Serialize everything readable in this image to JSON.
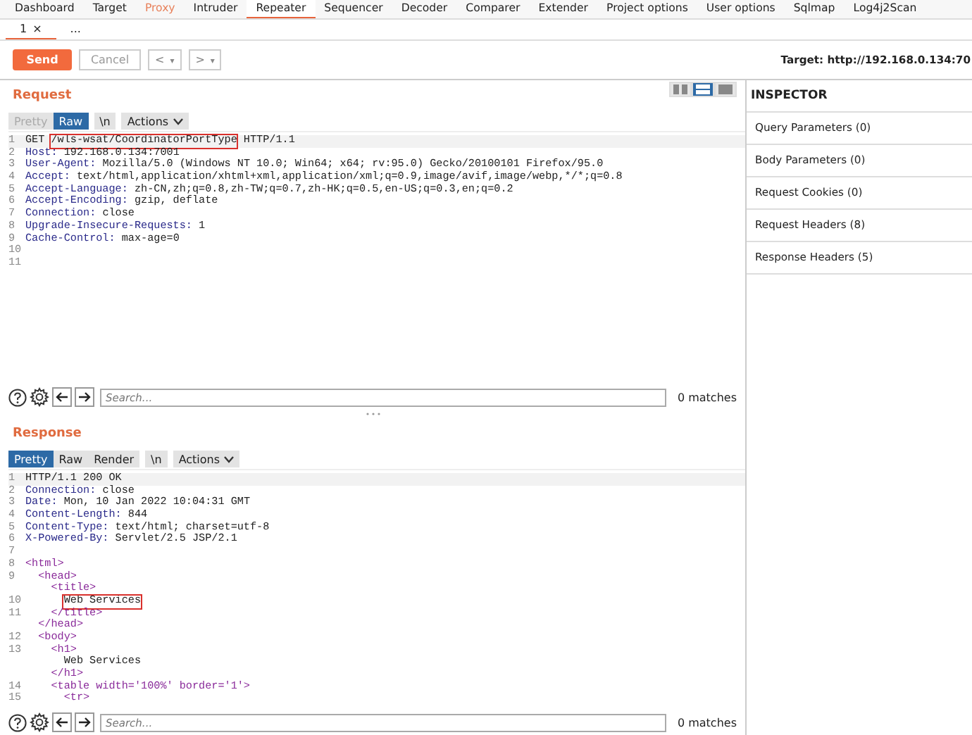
{
  "main_tabs": [
    {
      "label": "Dashboard",
      "selected": false,
      "alert": false
    },
    {
      "label": "Target",
      "selected": false,
      "alert": false
    },
    {
      "label": "Proxy",
      "selected": false,
      "alert": true
    },
    {
      "label": "Intruder",
      "selected": false,
      "alert": false
    },
    {
      "label": "Repeater",
      "selected": true,
      "alert": false
    },
    {
      "label": "Sequencer",
      "selected": false,
      "alert": false
    },
    {
      "label": "Decoder",
      "selected": false,
      "alert": false
    },
    {
      "label": "Comparer",
      "selected": false,
      "alert": false
    },
    {
      "label": "Extender",
      "selected": false,
      "alert": false
    },
    {
      "label": "Project options",
      "selected": false,
      "alert": false
    },
    {
      "label": "User options",
      "selected": false,
      "alert": false
    },
    {
      "label": "Sqlmap",
      "selected": false,
      "alert": false
    },
    {
      "label": "Log4j2Scan",
      "selected": false,
      "alert": false
    }
  ],
  "sub_tabs": [
    {
      "label": "1",
      "close": "×",
      "selected": true
    },
    {
      "label": "...",
      "selected": false
    }
  ],
  "toolbar": {
    "send": "Send",
    "cancel": {
      "label": "Cancel",
      "disabled": true
    },
    "back": "<",
    "forward": ">",
    "dropdown": "▾",
    "target": "Target: http://192.168.0.134:70"
  },
  "request": {
    "title": "Request",
    "view_modes": [
      {
        "selected": false
      },
      {
        "selected": true
      },
      {
        "selected": false
      }
    ],
    "format_tabs": [
      {
        "label": "Pretty",
        "selected": false,
        "disabled": true
      },
      {
        "label": "Raw",
        "selected": true,
        "disabled": false
      }
    ],
    "newline": "\\n",
    "actions": "Actions",
    "lines": [
      {
        "number": "1",
        "kind": "request_line",
        "method": "GET",
        "path": "/wls-wsat/CoordinatorPortType",
        "version": "HTTP/1.1",
        "highlighted": true
      },
      {
        "number": "2",
        "kind": "header",
        "name": "Host:",
        "value": "192.168.0.134:7001"
      },
      {
        "number": "3",
        "kind": "header",
        "name": "User-Agent:",
        "value": "Mozilla/5.0 (Windows NT 10.0; Win64; x64; rv:95.0) Gecko/20100101 Firefox/95.0"
      },
      {
        "number": "4",
        "kind": "header",
        "name": "Accept:",
        "value": "text/html,application/xhtml+xml,application/xml;q=0.9,image/avif,image/webp,*/*;q=0.8"
      },
      {
        "number": "5",
        "kind": "header",
        "name": "Accept-Language:",
        "value": "zh-CN,zh;q=0.8,zh-TW;q=0.7,zh-HK;q=0.5,en-US;q=0.3,en;q=0.2"
      },
      {
        "number": "6",
        "kind": "header",
        "name": "Accept-Encoding:",
        "value": "gzip, deflate"
      },
      {
        "number": "7",
        "kind": "header",
        "name": "Connection:",
        "value": "close"
      },
      {
        "number": "8",
        "kind": "header",
        "name": "Upgrade-Insecure-Requests:",
        "value": "1"
      },
      {
        "number": "9",
        "kind": "header",
        "name": "Cache-Control:",
        "value": "max-age=0"
      },
      {
        "number": "10",
        "kind": "blank"
      },
      {
        "number": "11",
        "kind": "blank"
      }
    ],
    "search": {
      "placeholder": "Search...",
      "matches": "0 matches"
    }
  },
  "response": {
    "title": "Response",
    "format_tabs": [
      {
        "label": "Pretty",
        "selected": true,
        "disabled": false
      },
      {
        "label": "Raw",
        "selected": false,
        "disabled": false
      },
      {
        "label": "Render",
        "selected": false,
        "disabled": false
      }
    ],
    "newline": "\\n",
    "actions": "Actions",
    "lines": [
      {
        "number": "1",
        "kind": "status_line",
        "text": "HTTP/1.1 200 OK"
      },
      {
        "number": "2",
        "kind": "header",
        "name": "Connection:",
        "value": "close"
      },
      {
        "number": "3",
        "kind": "header",
        "name": "Date:",
        "value": "Mon, 10 Jan 2022 10:04:31 GMT"
      },
      {
        "number": "4",
        "kind": "header",
        "name": "Content-Length:",
        "value": "844"
      },
      {
        "number": "5",
        "kind": "header",
        "name": "Content-Type:",
        "value": "text/html; charset=utf-8"
      },
      {
        "number": "6",
        "kind": "header",
        "name": "X-Powered-By:",
        "value": "Servlet/2.5 JSP/2.1"
      },
      {
        "number": "7",
        "kind": "blank"
      }
    ],
    "body": [
      {
        "number": "8",
        "kind": "tag",
        "text": "<html>",
        "children": [
          {
            "number": "9",
            "kind": "tag",
            "text": "<head>",
            "children": [
              {
                "kind": "tag",
                "text": "<title>",
                "children": [
                  {
                    "number": "10",
                    "kind": "text",
                    "text": "Web Services",
                    "highlighted": true
                  }
                ]
              },
              {
                "number": "11",
                "kind": "tag",
                "text": "</title>"
              }
            ]
          },
          {
            "kind": "tag",
            "text": "</head>"
          },
          {
            "number": "12",
            "kind": "tag",
            "text": "<body>",
            "children": [
              {
                "number": "13",
                "kind": "tag",
                "text": "<h1>",
                "children": [
                  {
                    "kind": "text",
                    "text": "Web Services",
                    "highlighted": false
                  }
                ]
              },
              {
                "kind": "tag",
                "text": "</h1>"
              },
              {
                "number": "14",
                "kind": "tag",
                "text": "<table width='100%' border='1'>",
                "children": [
                  {
                    "number": "15",
                    "kind": "tag",
                    "text": "<tr>"
                  }
                ]
              }
            ]
          }
        ]
      }
    ],
    "search": {
      "placeholder": "Search...",
      "matches": "0 matches"
    }
  },
  "inspector": {
    "title": "INSPECTOR",
    "items": [
      "Query Parameters (0)",
      "Body Parameters (0)",
      "Request Cookies (0)",
      "Request Headers (8)",
      "Response Headers (5)"
    ]
  }
}
